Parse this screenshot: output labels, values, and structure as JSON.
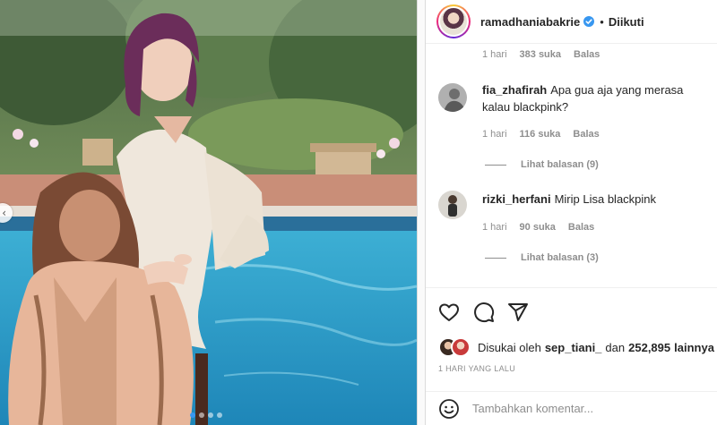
{
  "post": {
    "username": "ramadhaniabakrie",
    "separator": "•",
    "follow_status": "Diikuti"
  },
  "comments": {
    "top_meta": {
      "time": "1 hari",
      "likes": "383 suka",
      "reply": "Balas"
    },
    "items": [
      {
        "username": "fia_zhafirah",
        "text": "Apa gua aja yang merasa kalau blackpink?",
        "time": "1 hari",
        "likes": "116 suka",
        "reply": "Balas",
        "view_replies": "Lihat balasan (9)"
      },
      {
        "username": "rizki_herfani",
        "text": "Mirip Lisa blackpink",
        "time": "1 hari",
        "likes": "90 suka",
        "reply": "Balas",
        "view_replies": "Lihat balasan (3)"
      }
    ]
  },
  "likes": {
    "prefix": "Disukai oleh",
    "user": "sep_tiani_",
    "middle": "dan",
    "count": "252,895",
    "suffix": "lainnya"
  },
  "date": "1 HARI YANG LALU",
  "add_comment": {
    "placeholder": "Tambahkan komentar..."
  },
  "icons": {
    "like": "heart-icon",
    "comment": "comment-icon",
    "share": "share-icon",
    "emoji": "emoji-icon",
    "verified": "verified-badge-icon",
    "prev": "chevron-left-icon"
  },
  "colors": {
    "verified": "#3897f0",
    "muted": "#8e8e8e",
    "text": "#262626",
    "border": "#efefef"
  },
  "carousel": {
    "slide_count": 4,
    "active_slide": 1
  }
}
